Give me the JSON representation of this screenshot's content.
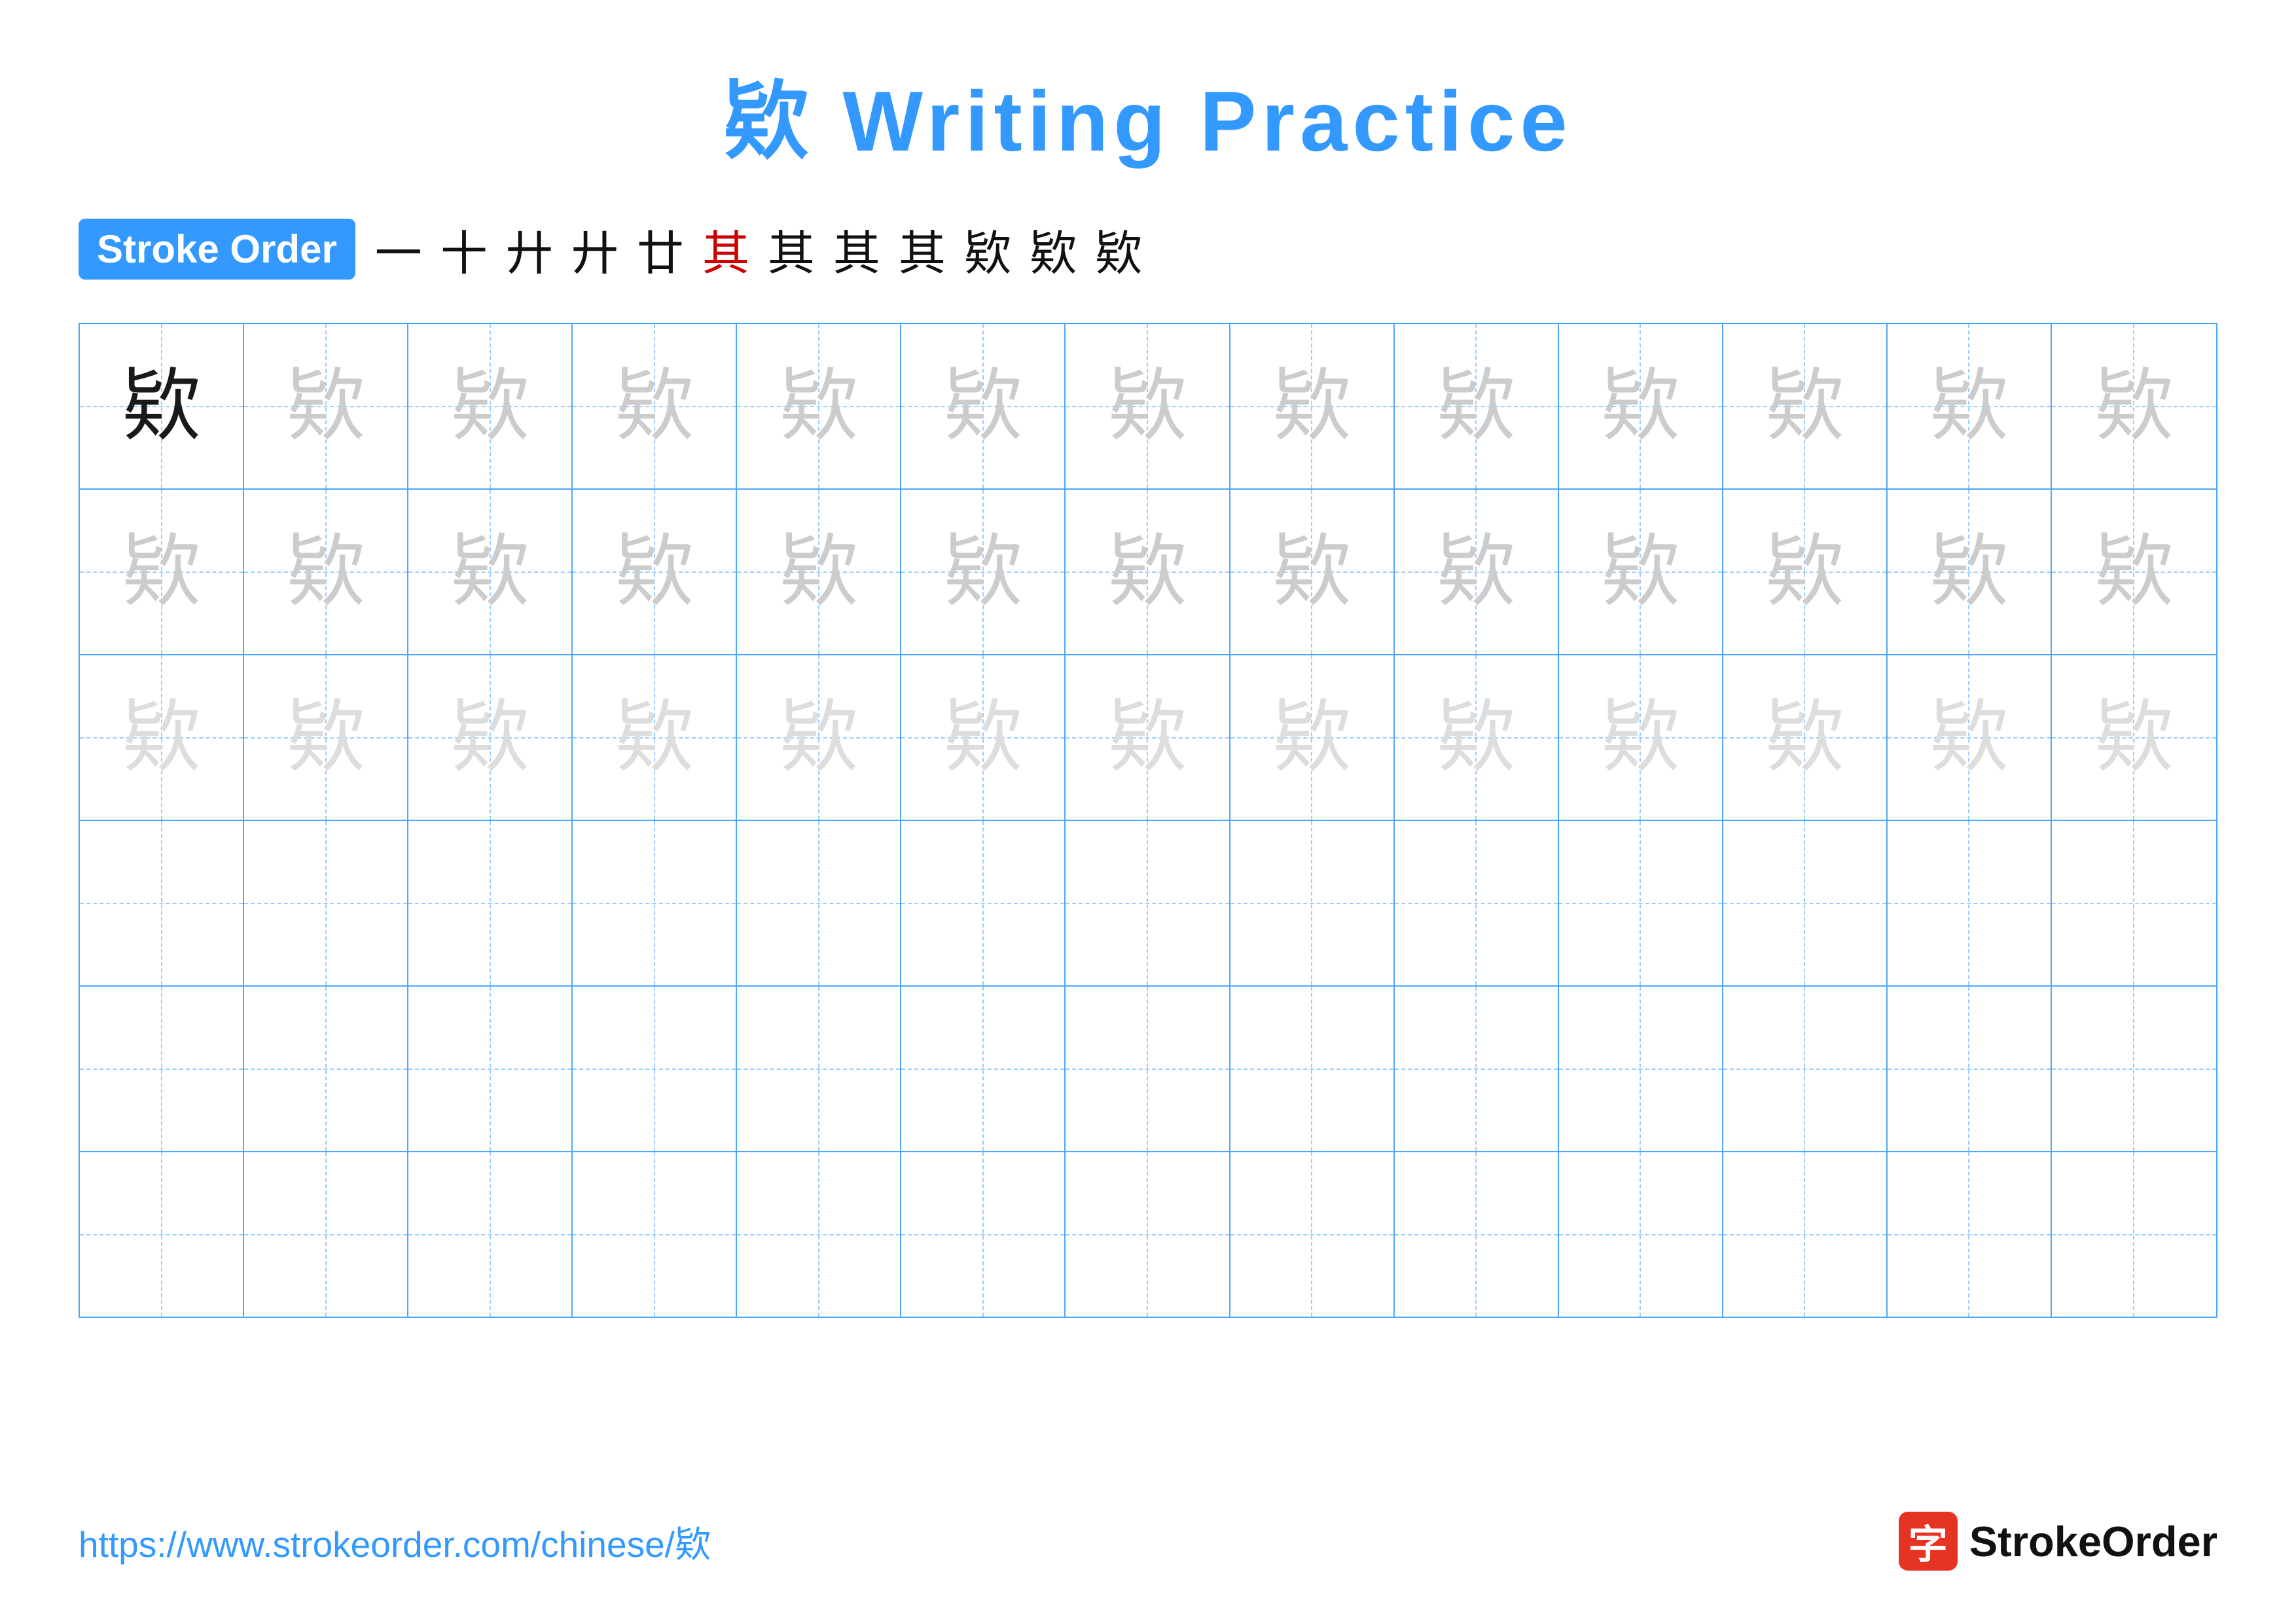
{
  "title": {
    "char": "欵",
    "label": "Writing Practice"
  },
  "stroke_order": {
    "badge": "Stroke Order",
    "steps": [
      {
        "char": "一",
        "style": "black"
      },
      {
        "char": "十",
        "style": "black"
      },
      {
        "char": "廾",
        "style": "black"
      },
      {
        "char": "廾",
        "style": "black"
      },
      {
        "char": "廿",
        "style": "black"
      },
      {
        "char": "其",
        "style": "red"
      },
      {
        "char": "其",
        "style": "black"
      },
      {
        "char": "其",
        "style": "black"
      },
      {
        "char": "其",
        "style": "black"
      },
      {
        "char": "欵",
        "style": "black"
      },
      {
        "char": "欵",
        "style": "black"
      },
      {
        "char": "欵",
        "style": "black"
      }
    ]
  },
  "grid": {
    "char": "欵",
    "rows": 6,
    "cols": 13,
    "row_styles": [
      "dark",
      "light",
      "lighter",
      "empty",
      "empty",
      "empty"
    ]
  },
  "footer": {
    "url": "https://www.strokeorder.com/chinese/欵",
    "logo_char": "字",
    "logo_text": "StrokeOrder"
  }
}
